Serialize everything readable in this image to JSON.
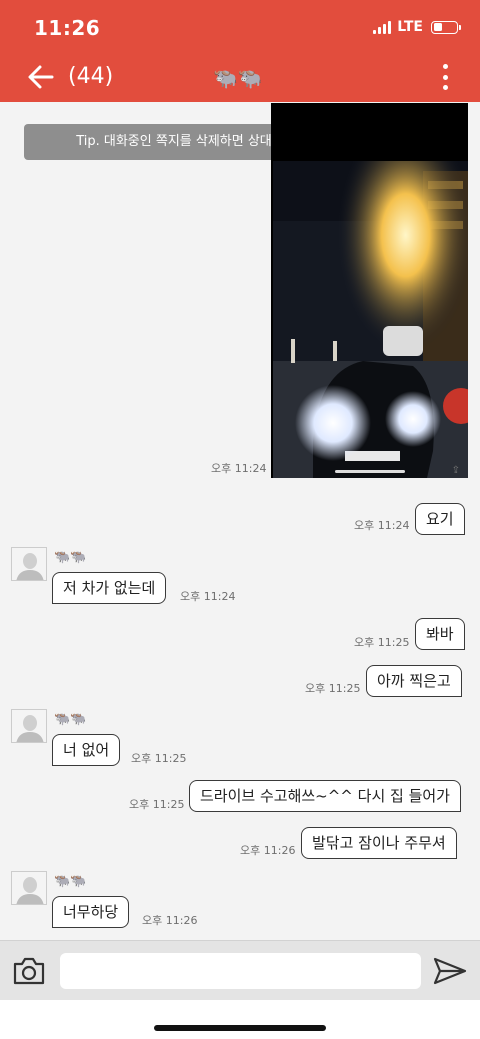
{
  "status_bar": {
    "time": "11:26",
    "network": "LTE",
    "battery_level": 0.35
  },
  "header": {
    "unread_count": "(44)",
    "title": "🐃🐃",
    "bg_color": "#e24d3d"
  },
  "tip": "Tip. 대화중인 쪽지를 삭제하면 상대방의 쪽지도 삭제됩니다.",
  "photo": {
    "time": "오후 11:24",
    "caption": ""
  },
  "messages": [
    {
      "side": "mine",
      "text": "요기",
      "time": "오후 11:24"
    },
    {
      "side": "theirs",
      "sender": "🐃🐃",
      "text": "저 차가 없는데",
      "time": "오후 11:24"
    },
    {
      "side": "mine",
      "text": "봐바",
      "time": "오후 11:25"
    },
    {
      "side": "mine",
      "text": "아까 찍은고",
      "time": "오후 11:25"
    },
    {
      "side": "theirs",
      "sender": "🐃🐃",
      "text": "너 없어",
      "time": "오후 11:25"
    },
    {
      "side": "mine",
      "text": "드라이브 수고해쓰~^^ 다시 집 들어가",
      "time": "오후 11:25"
    },
    {
      "side": "mine",
      "text": "발닦고 잠이나 주무셔",
      "time": "오후 11:26"
    },
    {
      "side": "theirs",
      "sender": "🐃🐃",
      "text": "너무하당",
      "time": "오후 11:26"
    }
  ],
  "input": {
    "placeholder": "",
    "value": ""
  },
  "icons": {
    "back": "arrow-left-icon",
    "menu": "more-vertical-icon",
    "camera": "camera-icon",
    "send": "send-icon"
  }
}
